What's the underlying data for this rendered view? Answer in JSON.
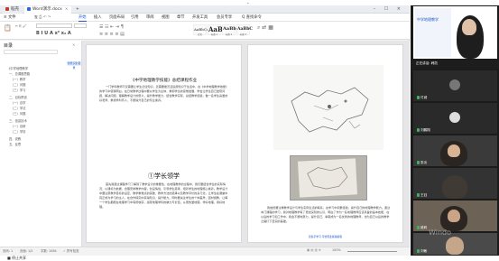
{
  "window": {
    "top_arrow": "⌄",
    "tabs": [
      {
        "label": "稻壳",
        "color": "#c0392b"
      },
      {
        "label": "Word演示.docx",
        "color": "#2b65d9"
      }
    ],
    "menu": [
      "≡ 文件",
      "开始",
      "插入",
      "页面布局",
      "引用",
      "审阅",
      "视图",
      "章节",
      "开发工具",
      "会员专享",
      "Q 查找命令"
    ],
    "active_menu_index": 1,
    "styles": [
      {
        "sample": "AaBbCcI",
        "name": "正文"
      },
      {
        "sample": "AaBl",
        "name": "标题 1"
      },
      {
        "sample": "AaBbC",
        "name": "标题 2"
      },
      {
        "sample": "AaBbC",
        "name": "标题 3"
      }
    ]
  },
  "nav": {
    "title": "目录",
    "toc_button": "智能识别目录",
    "items": [
      "《中学地理教学",
      "一、总课题思路",
      "（一）教学",
      "（二）问题",
      "（三）学习",
      "二、目标预设",
      "（一）自学",
      "（二）学法",
      "（三）问题",
      "三、信息技术",
      "（一）自研",
      "（二）学情",
      "四、说教",
      "五、反思"
    ]
  },
  "doc": {
    "left_page": {
      "title": "《中学地理教学技能》总结课程作业",
      "para1": "一门学科教师不仅需要让学生记住知识，还需要能灵活运用知识于生活中，在《中学地理教学技能》的学习中使我明白，在日常教学过程中要以学生为主体，重视学生的思维发展，学会让学生自己发现问题、解决问题，理解教学设计的意义，提升教学能力，结合教学实际，总结教学经验，做一名学生喜爱的好老师，重视学科育人，不断提升自己的专业素养。",
      "section": "①学长领学",
      "para2": "首先我通过课程学习了解到了教学设计的重要性，在地理教学的过程中，我们要结合学生的实际情况，以课标为依据，合理安排教学内容，创设情境，引导学生思考，培养学生的地理核心素养。教学设计中要注意教学目标的设定，教学重难点的突破，教学方法的选择以及教学评价的多元化，让学生在课堂中真正成为学习的主人，在合作探究中获得知识、提升能力。同时要关注学生的个体差异，因材施教，让每一个学生都能在地理学习中有所收获，感受地理学科的魅力与价值，从而热爱地理，学好地理，用好地理。"
    },
    "right_page": {
      "para": "我始终要注重教学设计与学生实际生活的联系，在学习中积累经验，提升自己的地理教学能力。通过本门课程的学习，我对地理教学有了更加深刻的认识，明白了作为一名地理教师应该具备的基本技能，在以后的学习和工作中，我会不断地努力，提升自己，争取成为一名优秀的地理教师，也为自己以后的教学之路打下坚实的基础。",
      "footer": "仅提示学习 可仿照此模版编辑"
    }
  },
  "status": {
    "page": "页码: 1",
    "pages": "页面: 1/2",
    "words": "字数: 1084",
    "check": "✓ 拼写检查",
    "zoom": "100%"
  },
  "share": {
    "bar": "正在讲话: 韩凯",
    "title": "中学地理教学"
  },
  "participants": [
    {
      "name": "付城"
    },
    {
      "name": "刘鹏翔"
    },
    {
      "name": "张淡"
    },
    {
      "name": "王钰"
    },
    {
      "name": "姚莉"
    },
    {
      "name": "刘敏"
    }
  ],
  "overlay": {
    "text": "Windo"
  },
  "bottom": {
    "text": "■ 停止共享"
  }
}
